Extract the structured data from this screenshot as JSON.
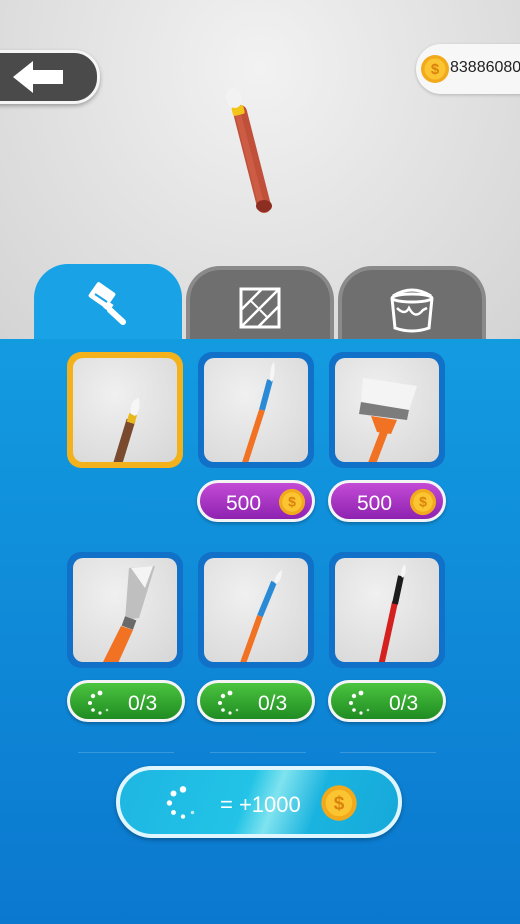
{
  "header": {
    "coins": "83886080"
  },
  "tabs": [
    {
      "icon": "paint-brush-icon",
      "active": true
    },
    {
      "icon": "tile-pattern-icon",
      "active": false
    },
    {
      "icon": "paint-bucket-icon",
      "active": false
    }
  ],
  "tools": [
    {
      "name": "thin-brown-brush",
      "selected": true
    },
    {
      "name": "blue-orange-brush",
      "price": "500"
    },
    {
      "name": "wide-paint-brush",
      "price": "500"
    },
    {
      "name": "palette-knife",
      "progress": "0/3"
    },
    {
      "name": "blue-fine-brush",
      "progress": "0/3"
    },
    {
      "name": "red-black-brush",
      "progress": "0/3"
    }
  ],
  "bonus": {
    "label": "= +1000"
  },
  "colors": {
    "panel": "#139be0",
    "selected_border": "#f3b21b",
    "price_pill": "#a534c3",
    "progress_pill": "#2fa52e",
    "bonus_button": "#22c3e6"
  }
}
